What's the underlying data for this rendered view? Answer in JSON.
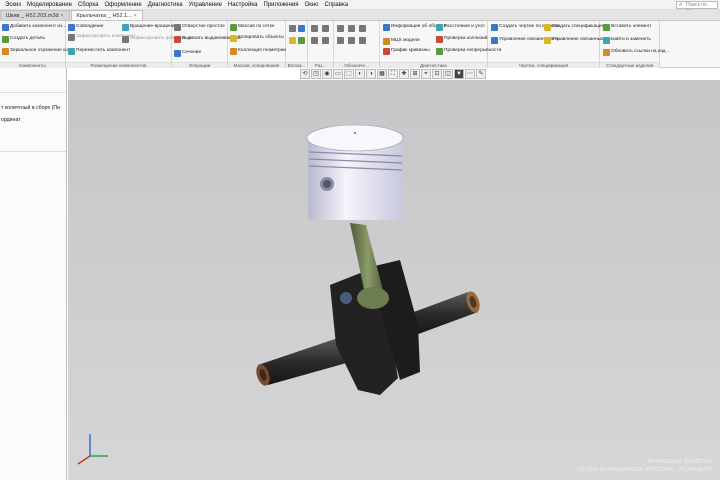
{
  "menu": [
    "Эскиз",
    "Моделирование",
    "Сборка",
    "Оформление",
    "Диагностика",
    "Управление",
    "Настройка",
    "Приложения",
    "Окно",
    "Справка"
  ],
  "search_placeholder": "Поиск по ко...",
  "tabs": [
    {
      "label": "Шкив _ Н52.203.m3d",
      "active": false
    },
    {
      "label": "Крыльчатка _ Н52.1...",
      "active": true
    }
  ],
  "ribbon": {
    "components": {
      "name": "Компоненты",
      "add_component": "Добавить компонент из...",
      "create_part": "Создать деталь",
      "mirror": "Зеркальное отражение ко..."
    },
    "placement": {
      "name": "Размещение компонентов",
      "coincidence": "Совпадение",
      "attach": "Зафиксировать компонент",
      "move": "Переместить компонент",
      "rotate": "Вращение-вращение",
      "attach2": "Зафиксировать фиксирация"
    },
    "operations": {
      "name": "Операции",
      "hole": "Отверстие простое",
      "extrude": "Вырезать выдавливанием",
      "section": "Сечение"
    },
    "array": {
      "name": "Массив, копирование",
      "array_grid": "Массив по сетке",
      "copy_objects": "Копировать объекты",
      "collection": "Коллекция геометрии"
    },
    "aux": {
      "name": "Вспом..."
    },
    "dims": {
      "name": "Раз..."
    },
    "notation": {
      "name": "Обозначе..."
    },
    "diagnostics": {
      "name": "Диагностика",
      "info": "Информация об объекте",
      "mcc": "МЦХ модели",
      "curvature": "График кривизны",
      "distance": "Расстояние и угол",
      "collision": "Проверка коллизий",
      "continuity": "Проверка непрерывности"
    },
    "drawing": {
      "name": "Чертеж, спецификация",
      "create_drawing": "Создать чертеж по модели",
      "manage_linked": "Управление связанными ч...",
      "create_spec": "Создать спецификацию...",
      "manage_linked2": "Управление связанными с..."
    },
    "standard": {
      "name": "Стандартные изделия",
      "insert": "Вставить элемент",
      "find_replace": "Найти и заменить",
      "refresh": "Обновить ссылки на изд..."
    }
  },
  "left_panel": {
    "row1": "т количтный в сборе (Пи",
    "row2": "ординат",
    "row3": "",
    "row4": ""
  },
  "watermark": {
    "line1": "Активация Windows",
    "line2": "Чтобы активировать Windows, перейдите"
  },
  "colors": {
    "viewport": "#c9c9cb",
    "piston": "#e8e8f4",
    "rod": "#8a9a6a",
    "crank": "#2a2a2a"
  },
  "view_buttons": [
    "⟲",
    "◳",
    "◉",
    "▭",
    "⬚",
    "◐",
    "◑",
    "▦",
    "⛶",
    "✚",
    "⊞",
    "⌖",
    "⊡",
    "◫",
    "▼",
    "⋯",
    "✎"
  ]
}
